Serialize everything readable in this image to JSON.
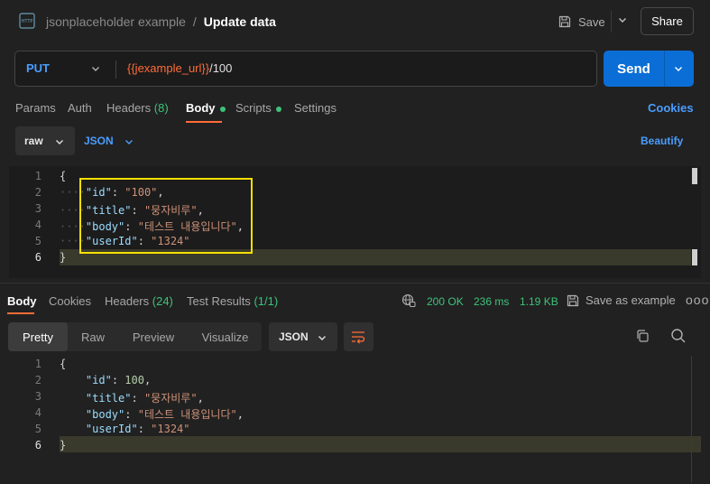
{
  "header": {
    "collection": "jsonplaceholder example",
    "separator": "/",
    "request_name": "Update data",
    "save_label": "Save",
    "share_label": "Share"
  },
  "url_bar": {
    "method": "PUT",
    "url_variable": "{{jexample_url}}",
    "url_path": "/100",
    "send_label": "Send"
  },
  "request_tabs": {
    "params": "Params",
    "auth": "Auth",
    "headers": "Headers",
    "headers_count": "(8)",
    "body": "Body",
    "scripts": "Scripts",
    "settings": "Settings",
    "cookies": "Cookies"
  },
  "body_mode": {
    "mode": "raw",
    "format": "JSON",
    "beautify": "Beautify"
  },
  "request_body": {
    "line_numbers": [
      "1",
      "2",
      "3",
      "4",
      "5",
      "6"
    ],
    "open_brace": "{",
    "close_brace": "}",
    "lines": [
      {
        "key": "\"id\"",
        "value": "\"100\"",
        "trail": ","
      },
      {
        "key": "\"title\"",
        "value": "\"뭉자비루\"",
        "trail": ","
      },
      {
        "key": "\"body\"",
        "value": "\"테스트 내용입니다\"",
        "trail": ","
      },
      {
        "key": "\"userId\"",
        "value": "\"1324\"",
        "trail": ""
      }
    ]
  },
  "response_tabs": {
    "body": "Body",
    "cookies": "Cookies",
    "headers": "Headers",
    "headers_count": "(24)",
    "test_results": "Test Results",
    "test_count": "(1/1)"
  },
  "response_meta": {
    "status": "200 OK",
    "time": "236 ms",
    "size": "1.19 KB",
    "save_example": "Save as example",
    "more": "ooo"
  },
  "response_view": {
    "pretty": "Pretty",
    "raw": "Raw",
    "preview": "Preview",
    "visualize": "Visualize",
    "format": "JSON"
  },
  "response_body": {
    "line_numbers": [
      "1",
      "2",
      "3",
      "4",
      "5",
      "6"
    ],
    "open_brace": "{",
    "close_brace": "}",
    "lines": [
      {
        "key": "\"id\"",
        "value": "100",
        "trail": ","
      },
      {
        "key": "\"title\"",
        "value": "\"뭉자비루\"",
        "trail": ","
      },
      {
        "key": "\"body\"",
        "value": "\"테스트 내용입니다\"",
        "trail": ","
      },
      {
        "key": "\"userId\"",
        "value": "\"1324\"",
        "trail": ""
      }
    ]
  },
  "colors": {
    "accent_orange": "#ff6c37",
    "link_blue": "#4a9dff",
    "send_blue": "#0b6ed6",
    "success_green": "#3ec27a",
    "highlight_yellow": "#f5e000"
  },
  "icons": {
    "http": "http-file-icon",
    "save": "floppy-icon",
    "globe": "globe-icon",
    "copy": "copy-icon",
    "search": "search-icon",
    "wrap": "wrap-lines-icon"
  }
}
